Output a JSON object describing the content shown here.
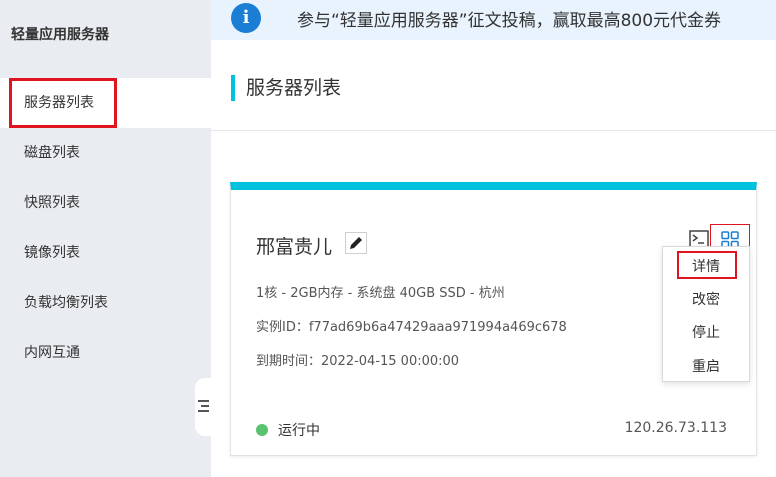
{
  "sidebar": {
    "title": "轻量应用服务器",
    "items": [
      {
        "label": "服务器列表"
      },
      {
        "label": "磁盘列表"
      },
      {
        "label": "快照列表"
      },
      {
        "label": "镜像列表"
      },
      {
        "label": "负载均衡列表"
      },
      {
        "label": "内网互通"
      }
    ],
    "collapse_icon": "collapse-icon"
  },
  "banner": {
    "icon": "i",
    "text": "参与“轻量应用服务器”征文投稿，赢取最高800元代金券"
  },
  "page": {
    "title": "服务器列表"
  },
  "server": {
    "name": "邢富贵儿",
    "spec": "1核 - 2GB内存 - 系统盘 40GB SSD - 杭州",
    "instance_id": "实例ID：f77ad69b6a47429aaa971994a469c678",
    "expiry": "到期时间：2022-04-15 00:00:00",
    "status": "运行中",
    "ip": "120.26.73.113"
  },
  "menu": {
    "items": [
      {
        "label": "详情"
      },
      {
        "label": "改密"
      },
      {
        "label": "停止"
      },
      {
        "label": "重启"
      }
    ]
  },
  "colors": {
    "accent": "#00c1de",
    "highlight": "#e0141e",
    "running": "#59c26d",
    "info": "#1a7ed4"
  }
}
